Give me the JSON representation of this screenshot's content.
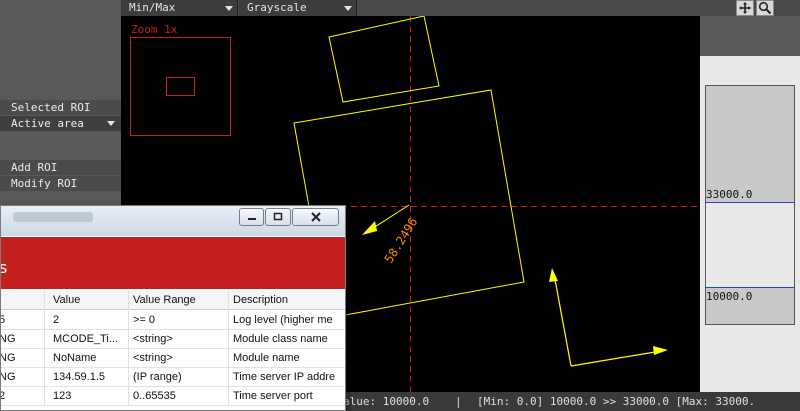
{
  "toolbar": {
    "dropdown1": "Min/Max",
    "dropdown2": "Grayscale",
    "icons": [
      "move-icon",
      "zoom-icon"
    ]
  },
  "left_panel": {
    "selected_roi": "Selected ROI",
    "active_area": "Active area",
    "add_roi": "Add ROI",
    "modify_roi": "Modify ROI"
  },
  "canvas": {
    "zoom_label": "Zoom 1x",
    "angle_label": "58.2496"
  },
  "colors": {
    "roi_yellow": "#ffff00",
    "zoom_red": "#c0241c",
    "crosshair_red": "#d01c1c",
    "angle_orange": "#ff8c00",
    "banner_red": "#c4201f",
    "histogram_line": "#2b3fc7"
  },
  "histogram": {
    "upper": "33000.0",
    "lower": "10000.0"
  },
  "status": {
    "value": "alue: 10000.0",
    "sep": "|",
    "range": "[Min: 0.0] 10000.0 >> 33000.0 [Max: 33000."
  },
  "dialog": {
    "banner_text": "s",
    "buttons": [
      "minimize",
      "maximize",
      "close"
    ],
    "columns": [
      "",
      "Value",
      "Value Range",
      "Description"
    ],
    "rows": [
      [
        "5",
        "2",
        ">= 0",
        "Log level (higher me"
      ],
      [
        "NG",
        "MCODE_Ti...",
        "<string>",
        "Module class name"
      ],
      [
        "NG",
        "NoName",
        "<string>",
        "Module name"
      ],
      [
        "NG",
        "134.59.1.5",
        "(IP range)",
        "Time server IP addre"
      ],
      [
        "2",
        "123",
        "0..65535",
        "Time server port"
      ]
    ]
  }
}
